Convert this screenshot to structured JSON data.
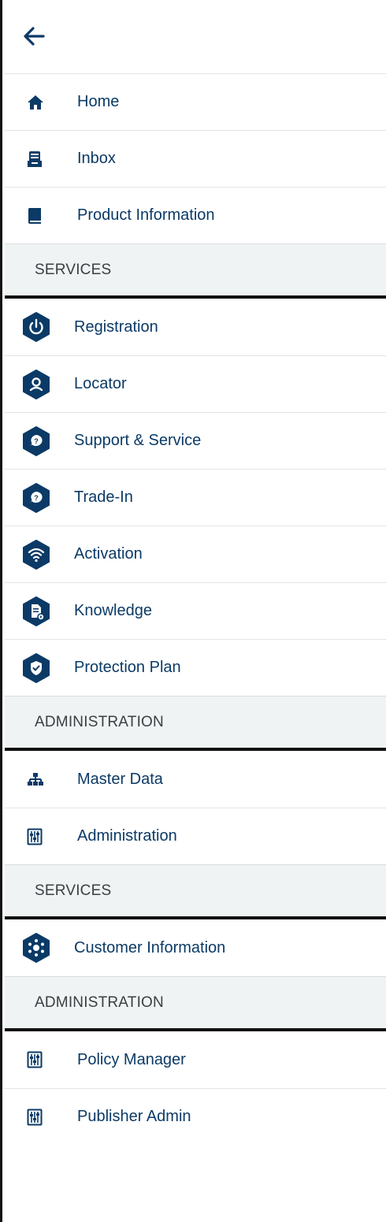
{
  "nav": {
    "back_label": "Back",
    "primary": [
      {
        "label": "Home",
        "icon": "home-icon"
      },
      {
        "label": "Inbox",
        "icon": "inbox-icon"
      },
      {
        "label": "Product Information",
        "icon": "book-icon"
      }
    ],
    "sections": [
      {
        "title": "SERVICES",
        "items": [
          {
            "label": "Registration",
            "icon": "power-icon"
          },
          {
            "label": "Locator",
            "icon": "location-icon"
          },
          {
            "label": "Support & Service",
            "icon": "help-chat-icon"
          },
          {
            "label": "Trade-In",
            "icon": "help-chat-icon"
          },
          {
            "label": "Activation",
            "icon": "wifi-icon"
          },
          {
            "label": "Knowledge",
            "icon": "document-icon"
          },
          {
            "label": "Protection Plan",
            "icon": "shield-icon"
          }
        ]
      },
      {
        "title": "ADMINISTRATION",
        "items": [
          {
            "label": "Master Data",
            "icon": "hierarchy-icon"
          },
          {
            "label": "Administration",
            "icon": "sliders-icon"
          }
        ]
      },
      {
        "title": "SERVICES",
        "items": [
          {
            "label": "Customer Information",
            "icon": "hub-icon"
          }
        ]
      },
      {
        "title": "ADMINISTRATION",
        "items": [
          {
            "label": "Policy Manager",
            "icon": "sliders-icon"
          },
          {
            "label": "Publisher Admin",
            "icon": "sliders-icon"
          }
        ]
      }
    ]
  },
  "colors": {
    "brand": "#0b3a66",
    "section_bg": "#f0f3f4",
    "divider": "#e1e4e6"
  }
}
